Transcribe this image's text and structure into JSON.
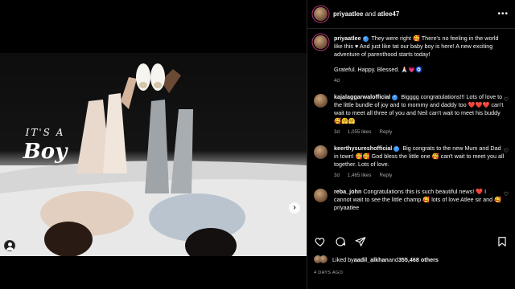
{
  "post": {
    "overlay_small": "IT'S A",
    "overlay_big": "Boy",
    "next_arrow": "›"
  },
  "header": {
    "user1": "priyaatlee",
    "and": " and ",
    "user2": "atlee47",
    "more": "•••"
  },
  "caption": {
    "user": "priyaatlee",
    "text": "They were right 🥰 There's no feeling in the world like this ♥ And just like tat our baby boy is here! A new exciting adventure of parenthood starts today!",
    "text2": "Grateful. Happy. Blessed. 🙏🏻💗🧿",
    "time": "4d"
  },
  "comments": [
    {
      "user": "kajalaggarwalofficial",
      "text": "Bigggg congratulations!!! Lots of love to the little bundle of joy and to mommy and daddy too ❤️❤️❤️ can't wait to meet all three of you and Neil can't wait to meet his buddy 🥰🤗🤗",
      "time": "3d",
      "likes": "1,055 likes",
      "reply": "Reply"
    },
    {
      "user": "keerthysureshofficial",
      "text": "Big congrats to the new Mum and Dad in town! 🥰🥰 God bless the little one 🥰 can't wait to meet you all together. Lots of love.",
      "time": "3d",
      "likes": "1,465 likes",
      "reply": "Reply"
    },
    {
      "user": "reba_john",
      "text": "Congratulations this is such beautiful news! ❤️ I cannot wait to see the little champ 🥰 lots of love Atlee sir and 🥰 priyaatlee",
      "time": "",
      "likes": "",
      "reply": ""
    }
  ],
  "likes": {
    "prefix": "Liked by ",
    "user": "aadil_alkhan",
    "middle": " and ",
    "count": "355,468 others"
  },
  "time_ago": "4 DAYS AGO",
  "colors": {
    "background": "#000000",
    "verified": "#3897f0",
    "muted": "#a8a8a8"
  }
}
